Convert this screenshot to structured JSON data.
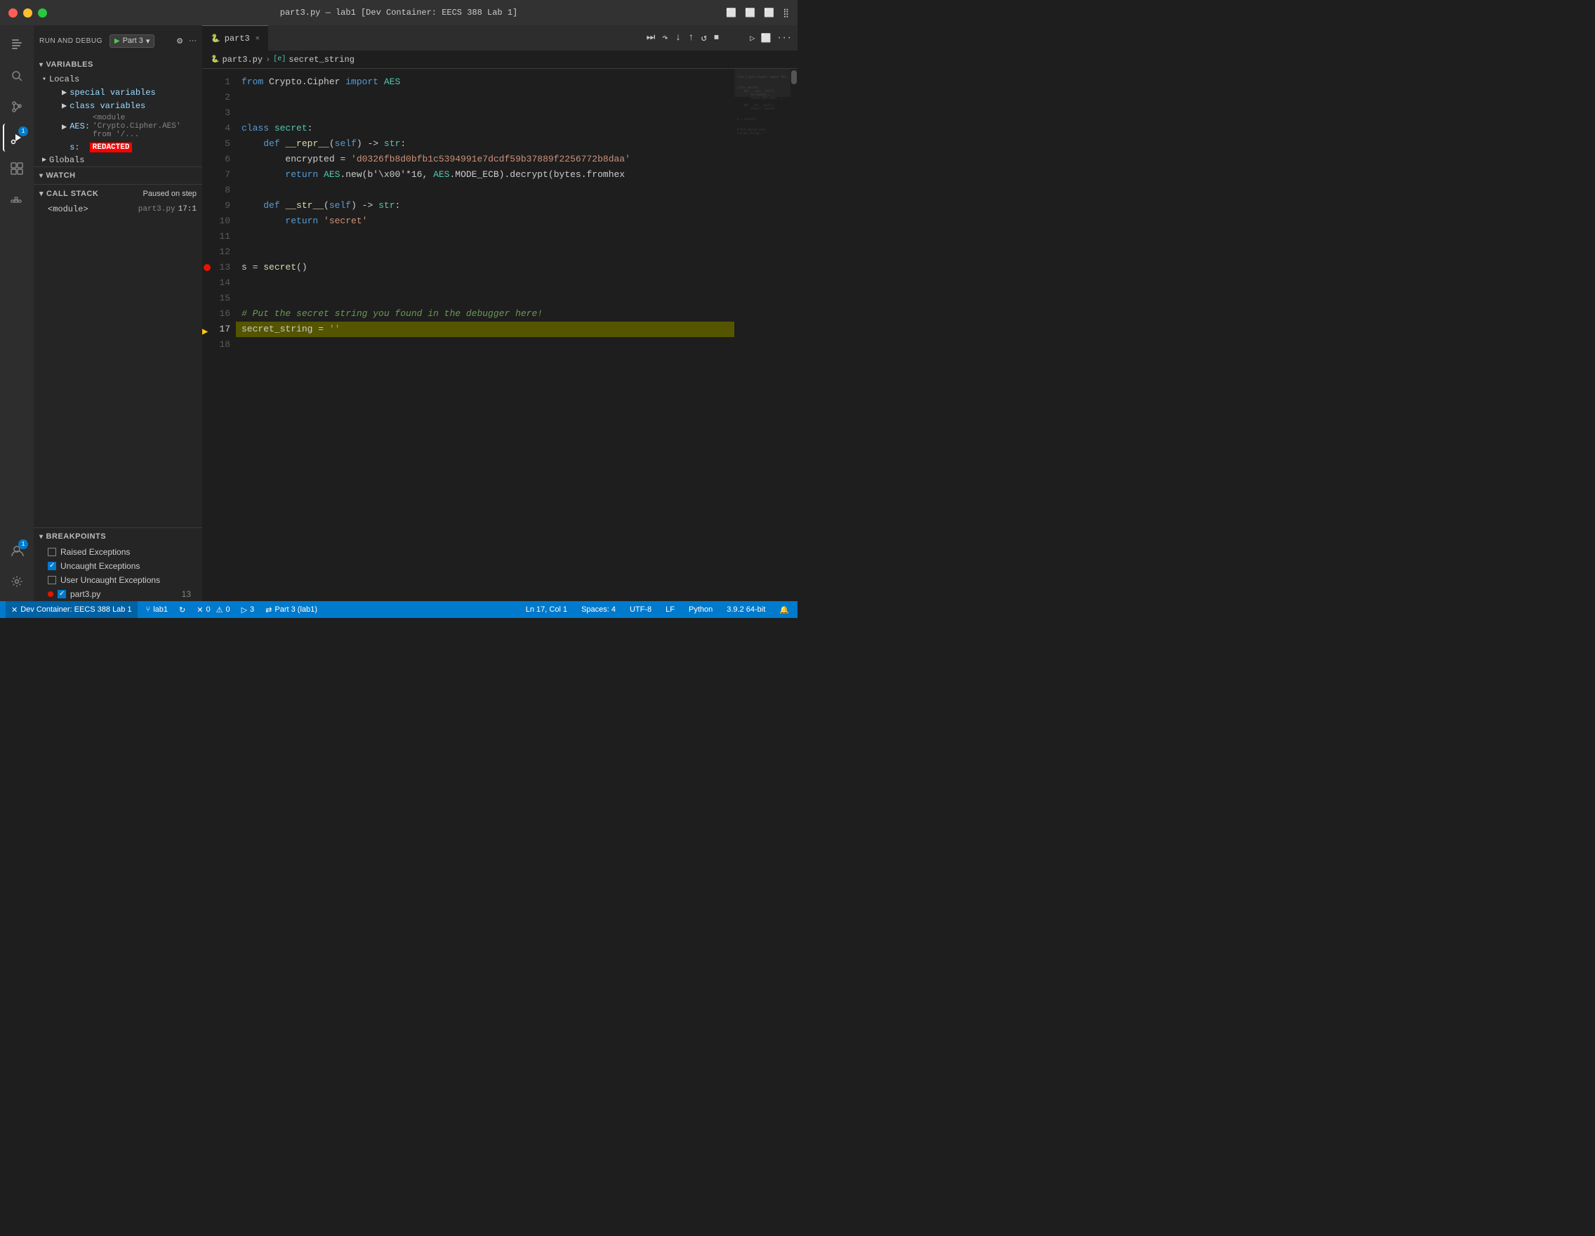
{
  "titlebar": {
    "title": "part3.py — lab1 [Dev Container: EECS 388 Lab 1]",
    "traffic_lights": [
      "red",
      "yellow",
      "green"
    ]
  },
  "activity_bar": {
    "items": [
      {
        "name": "explorer",
        "icon": "⬜",
        "active": false
      },
      {
        "name": "search",
        "icon": "🔍",
        "active": false
      },
      {
        "name": "source-control",
        "icon": "⑂",
        "active": false
      },
      {
        "name": "run-debug",
        "icon": "▷",
        "active": true,
        "badge": "1"
      },
      {
        "name": "extensions",
        "icon": "⊞",
        "active": false
      }
    ],
    "bottom_items": [
      {
        "name": "remote",
        "icon": "👤",
        "badge": "1"
      },
      {
        "name": "settings",
        "icon": "⚙",
        "active": false
      },
      {
        "name": "docker",
        "icon": "🐳",
        "active": false
      }
    ]
  },
  "sidebar": {
    "debug_toolbar": {
      "label": "RUN AND DEBUG",
      "config_name": "Part 3",
      "gear_label": "⚙",
      "more_label": "···"
    },
    "variables": {
      "section_label": "VARIABLES",
      "locals": {
        "label": "Locals",
        "items": [
          {
            "name": "special variables",
            "type": "group"
          },
          {
            "name": "class variables",
            "type": "group"
          },
          {
            "name": "AES",
            "value": "<module 'Crypto.Cipher.AES' from '/...",
            "type": "item"
          },
          {
            "name": "s:",
            "value": "REDACTED",
            "type": "redacted"
          }
        ]
      },
      "globals": {
        "label": "Globals"
      }
    },
    "watch": {
      "section_label": "WATCH"
    },
    "callstack": {
      "section_label": "CALL STACK",
      "status": "Paused on step",
      "frames": [
        {
          "name": "<module>",
          "file": "part3.py",
          "location": "17:1"
        }
      ]
    },
    "breakpoints": {
      "section_label": "BREAKPOINTS",
      "items": [
        {
          "label": "Raised Exceptions",
          "checked": false,
          "dot": false
        },
        {
          "label": "Uncaught Exceptions",
          "checked": true,
          "dot": false
        },
        {
          "label": "User Uncaught Exceptions",
          "checked": false,
          "dot": false
        },
        {
          "label": "part3.py",
          "checked": true,
          "dot": true,
          "count": "13"
        }
      ]
    }
  },
  "editor": {
    "tab": {
      "label": "part3.py",
      "icon": "🐍"
    },
    "debug_buttons": [
      "⏸",
      "▷",
      "↺",
      "↓",
      "↑",
      "↩",
      "⏹"
    ],
    "breadcrumb": {
      "parts": [
        "part3.py",
        "secret_string"
      ]
    },
    "lines": [
      {
        "num": 1,
        "code": "from Crypto.Cipher import AES",
        "tokens": [
          {
            "text": "from ",
            "class": "kw"
          },
          {
            "text": "Crypto.Cipher",
            "class": ""
          },
          {
            "text": " import ",
            "class": "kw"
          },
          {
            "text": "AES",
            "class": "cls"
          }
        ]
      },
      {
        "num": 2,
        "code": ""
      },
      {
        "num": 3,
        "code": ""
      },
      {
        "num": 4,
        "code": "class secret:",
        "tokens": [
          {
            "text": "class ",
            "class": "kw"
          },
          {
            "text": "secret",
            "class": "cls"
          },
          {
            "text": ":",
            "class": ""
          }
        ]
      },
      {
        "num": 5,
        "code": "    def __repr__(self) -> str:",
        "tokens": [
          {
            "text": "    ",
            "class": ""
          },
          {
            "text": "def ",
            "class": "kw"
          },
          {
            "text": "__repr__",
            "class": "fn"
          },
          {
            "text": "(",
            "class": ""
          },
          {
            "text": "self",
            "class": "self-kw"
          },
          {
            "text": ") -> ",
            "class": ""
          },
          {
            "text": "str",
            "class": "cls"
          },
          {
            "text": ":",
            "class": ""
          }
        ]
      },
      {
        "num": 6,
        "code": "        encrypted = 'd0326fb8d0bfb1c5394991e7dcdf59b37889f2256772b8daa...'",
        "tokens": [
          {
            "text": "        encrypted = ",
            "class": ""
          },
          {
            "text": "'d0326fb8d0bfb1c5394991e7dcdf59b37889f2256772b8daa'",
            "class": "str"
          }
        ]
      },
      {
        "num": 7,
        "code": "        return AES.new(b'\\x00'*16, AES.MODE_ECB).decrypt(bytes.fromhex...",
        "tokens": [
          {
            "text": "        ",
            "class": ""
          },
          {
            "text": "return ",
            "class": "kw"
          },
          {
            "text": "AES",
            "class": "cls"
          },
          {
            "text": ".new(b'\\x00'*16, AES.MODE_ECB).decrypt(bytes.fromhex",
            "class": ""
          }
        ]
      },
      {
        "num": 8,
        "code": ""
      },
      {
        "num": 9,
        "code": "    def __str__(self) -> str:",
        "tokens": [
          {
            "text": "    ",
            "class": ""
          },
          {
            "text": "def ",
            "class": "kw"
          },
          {
            "text": "__str__",
            "class": "fn"
          },
          {
            "text": "(",
            "class": ""
          },
          {
            "text": "self",
            "class": "self-kw"
          },
          {
            "text": ") -> ",
            "class": ""
          },
          {
            "text": "str",
            "class": "cls"
          },
          {
            "text": ":",
            "class": ""
          }
        ]
      },
      {
        "num": 10,
        "code": "        return 'secret'",
        "tokens": [
          {
            "text": "        ",
            "class": ""
          },
          {
            "text": "return ",
            "class": "kw"
          },
          {
            "text": "'secret'",
            "class": "str"
          }
        ]
      },
      {
        "num": 11,
        "code": ""
      },
      {
        "num": 12,
        "code": ""
      },
      {
        "num": 13,
        "code": "s = secret()",
        "breakpoint": true
      },
      {
        "num": 14,
        "code": ""
      },
      {
        "num": 15,
        "code": ""
      },
      {
        "num": 16,
        "code": "# Put the secret string you found in the debugger here!",
        "comment": true
      },
      {
        "num": 17,
        "code": "secret_string = ''",
        "current": true,
        "debug_arrow": true
      },
      {
        "num": 18,
        "code": ""
      }
    ]
  },
  "status_bar": {
    "remote": "Dev Container: EECS 388 Lab 1",
    "branch": "lab1",
    "sync": "↻",
    "errors": "0",
    "warnings": "0",
    "run": "3",
    "debug_config": "Part 3 (lab1)",
    "position": "Ln 17, Col 1",
    "spaces": "Spaces: 4",
    "encoding": "UTF-8",
    "line_ending": "LF",
    "language": "Python",
    "version": "3.9.2 64-bit",
    "notification_icon": "🔔"
  }
}
